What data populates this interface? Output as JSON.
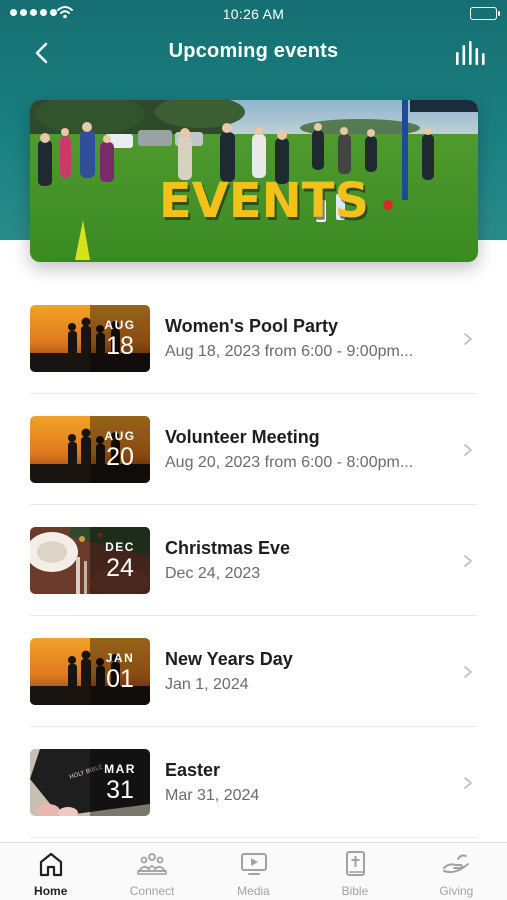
{
  "status_bar": {
    "time": "10:26 AM"
  },
  "nav": {
    "title": "Upcoming events"
  },
  "hero": {
    "banner_text": "EVENTS"
  },
  "events": [
    {
      "title": "Women's Pool Party",
      "subtitle": "Aug 18, 2023 from 6:00 - 9:00pm...",
      "month": "AUG",
      "day": "18",
      "thumb": "sunset"
    },
    {
      "title": "Volunteer Meeting",
      "subtitle": "Aug 20, 2023 from 6:00 - 8:00pm...",
      "month": "AUG",
      "day": "20",
      "thumb": "sunset"
    },
    {
      "title": "Christmas Eve",
      "subtitle": "Dec 24, 2023",
      "month": "DEC",
      "day": "24",
      "thumb": "christmas"
    },
    {
      "title": "New Years Day",
      "subtitle": "Jan 1, 2024",
      "month": "JAN",
      "day": "01",
      "thumb": "sunset"
    },
    {
      "title": "Easter",
      "subtitle": "Mar 31, 2024",
      "month": "MAR",
      "day": "31",
      "thumb": "bible"
    }
  ],
  "tabs": [
    {
      "label": "Home",
      "icon": "home-icon",
      "active": true
    },
    {
      "label": "Connect",
      "icon": "connect-icon",
      "active": false
    },
    {
      "label": "Media",
      "icon": "media-icon",
      "active": false
    },
    {
      "label": "Bible",
      "icon": "bible-icon",
      "active": false
    },
    {
      "label": "Giving",
      "icon": "giving-icon",
      "active": false
    }
  ],
  "colors": {
    "header_teal": "#1a7f80",
    "tab_active": "#1f1f1f",
    "tab_inactive": "#a2a2a2",
    "banner_yellow": "#f2c21b"
  }
}
